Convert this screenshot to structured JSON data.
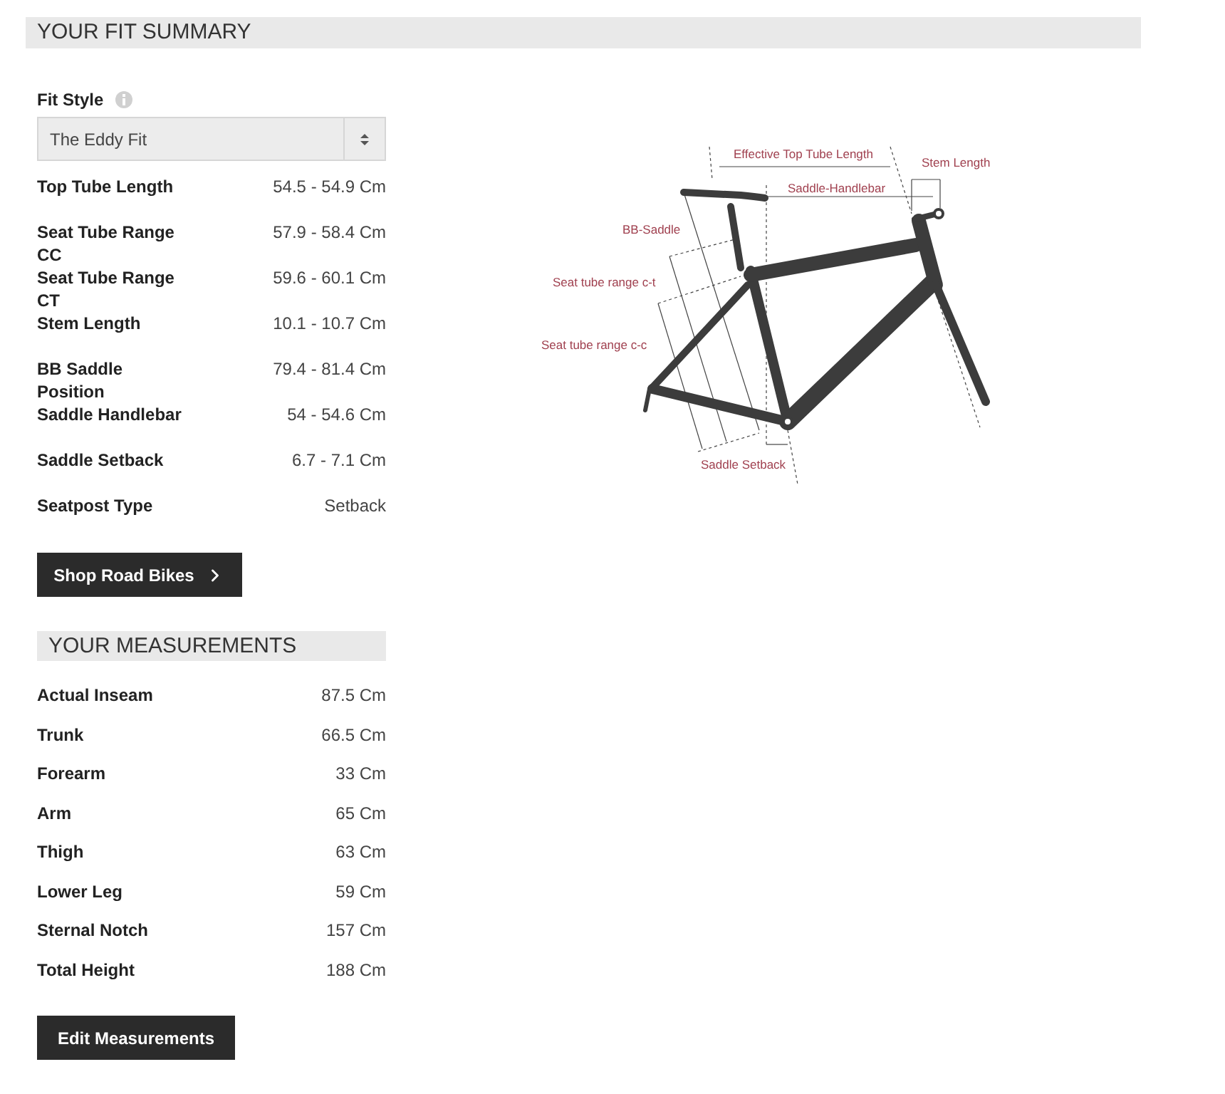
{
  "fit_summary": {
    "title": "YOUR FIT SUMMARY",
    "fit_style": {
      "label": "Fit Style",
      "value": "The Eddy Fit"
    },
    "rows": [
      {
        "label": "Top Tube Length",
        "value": "54.5 - 54.9 Cm"
      },
      {
        "label": "Seat Tube Range CC",
        "value": "57.9 - 58.4 Cm"
      },
      {
        "label": "Seat Tube Range CT",
        "value": "59.6 - 60.1 Cm"
      },
      {
        "label": "Stem Length",
        "value": "10.1 - 10.7 Cm"
      },
      {
        "label": "BB Saddle Position",
        "value": "79.4 - 81.4 Cm"
      },
      {
        "label": "Saddle Handlebar",
        "value": "54 - 54.6 Cm"
      },
      {
        "label": "Saddle Setback",
        "value": "6.7 - 7.1 Cm"
      },
      {
        "label": "Seatpost Type",
        "value": "Setback"
      }
    ],
    "button": "Shop Road Bikes"
  },
  "diagram": {
    "labels": [
      "Effective Top Tube Length",
      "Stem Length",
      "Saddle-Handlebar",
      "BB-Saddle",
      "Seat tube range c-t",
      "Seat tube range c-c",
      "Saddle Setback"
    ]
  },
  "measurements": {
    "title": "YOUR MEASUREMENTS",
    "rows": [
      {
        "label": "Actual Inseam",
        "value": "87.5 Cm"
      },
      {
        "label": "Trunk",
        "value": "66.5 Cm"
      },
      {
        "label": "Forearm",
        "value": "33 Cm"
      },
      {
        "label": "Arm",
        "value": "65 Cm"
      },
      {
        "label": "Thigh",
        "value": "63 Cm"
      },
      {
        "label": "Lower Leg",
        "value": "59 Cm"
      },
      {
        "label": "Sternal Notch",
        "value": "157 Cm"
      },
      {
        "label": "Total Height",
        "value": "188 Cm"
      }
    ],
    "button": "Edit Measurements"
  }
}
